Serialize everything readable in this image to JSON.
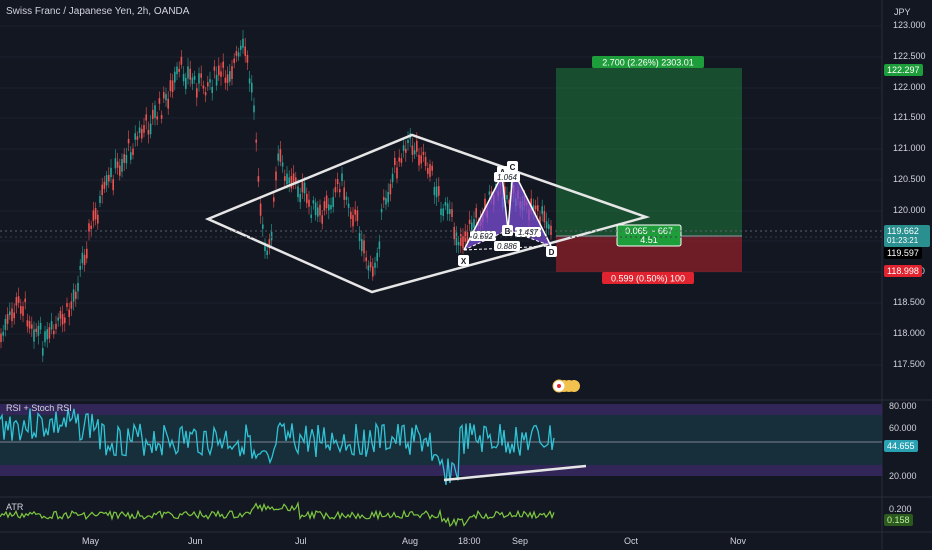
{
  "header": {
    "symbol_title": "Swiss Franc / Japanese Yen, 2h, OANDA",
    "currency": "JPY"
  },
  "price_axis": {
    "ticks": [
      "123.000",
      "122.500",
      "122.000",
      "121.500",
      "121.000",
      "120.500",
      "120.000",
      "119.500",
      "119.000",
      "118.500",
      "118.000",
      "117.500"
    ],
    "badges": {
      "target": "122.297",
      "last_price": "119.662",
      "countdown": "01:23:21",
      "entry": "119.597",
      "stop": "118.998"
    }
  },
  "time_axis": [
    "May",
    "Jun",
    "Jul",
    "Aug",
    "18:00",
    "Sep",
    "Oct",
    "Nov"
  ],
  "position_tool": {
    "profit_label": "2.700 (2.26%) 2303.01",
    "mid_label_line1": "0.065 ~ 667",
    "mid_label_line2": "4.51",
    "loss_label": "0.599 (0.50%) 100"
  },
  "pattern": {
    "points": [
      "X",
      "A",
      "B",
      "C",
      "D"
    ],
    "ratios": {
      "xb": "0.592",
      "ac": "1.064",
      "bd": "0.886",
      "xd": "1.437"
    }
  },
  "rsi_panel": {
    "label": "RSI + Stoch RSI",
    "ticks": [
      "80.000",
      "60.000",
      "20.000"
    ],
    "value": "44.655"
  },
  "atr_panel": {
    "label": "ATR",
    "ticks": [
      "0.200"
    ],
    "value": "0.158"
  },
  "colors": {
    "background": "#131722",
    "profit": "#089981",
    "loss": "#f23645",
    "rsi": "#2ec4d6",
    "atr": "#7ec83f",
    "pattern": "#7b4fd6"
  }
}
